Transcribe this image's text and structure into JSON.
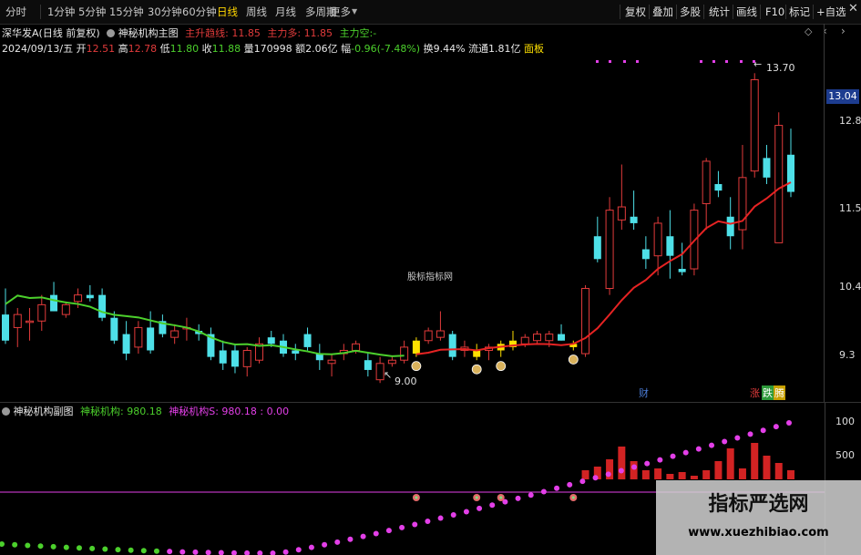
{
  "toolbar": {
    "tabs": [
      "分时",
      "1分钟",
      "5分钟",
      "15分钟",
      "30分钟",
      "60分钟",
      "日线",
      "周线",
      "月线",
      "多周期",
      "更多"
    ],
    "right_buttons": [
      "复权",
      "叠加",
      "多股",
      "统计",
      "画线",
      "F10",
      "标记",
      "+自选"
    ]
  },
  "info": {
    "stock_name": "深华发A",
    "period": "(日线 前复权)",
    "indicator_name": "神秘机构主图",
    "ind1_label": "主升趋线:",
    "ind1_value": "11.85",
    "ind2_label": "主力多:",
    "ind2_value": "11.85",
    "ind3_label": "主力空:",
    "ind3_value": "-",
    "date": "2024/09/13/五",
    "open_label": "开",
    "open": "12.51",
    "high_label": "高",
    "high": "12.78",
    "low_label": "低",
    "low": "11.80",
    "close_label": "收",
    "close": "11.88",
    "vol_label": "量",
    "vol": "170998",
    "amount_label": "额",
    "amount": "2.06亿",
    "change_label": "幅",
    "change": "-0.96(-7.48%)",
    "turnover": "换9.44%",
    "float": "流通1.81亿",
    "panel": "面板"
  },
  "axis": {
    "current_price": "13.04",
    "ticks": [
      "12.8",
      "11.5",
      "10.4",
      "9.3"
    ],
    "sub_ticks": [
      "100",
      "500"
    ]
  },
  "annotations": {
    "high_label": "13.70",
    "low_label": "9.00",
    "watermark_center": "股标指标网",
    "badge_cai": "财",
    "badge_zhang": "涨",
    "badge_die": "跌",
    "badge_teng": "腾"
  },
  "sub": {
    "title": "神秘机构副图",
    "s1_label": "神秘机构:",
    "s1_value": "980.18",
    "s2_label": "神秘机构S:",
    "s2_value": "980.18",
    "s3_value": ": 0.00"
  },
  "watermark": {
    "title": "指标严选网",
    "url": "www.xuezhibiao.com"
  },
  "colors": {
    "up": "#e23b3b",
    "down": "#4ee0e8",
    "ma_green": "#4cd02c",
    "ma_red": "#e62323",
    "yellow": "#ffe100",
    "magenta": "#e33fe8"
  },
  "chart_data": {
    "type": "candlestick",
    "price_range": [
      8.8,
      13.9
    ],
    "candles": [
      {
        "o": 10.0,
        "h": 10.4,
        "l": 9.55,
        "c": 9.6
      },
      {
        "o": 9.8,
        "h": 10.1,
        "l": 9.5,
        "c": 10.0
      },
      {
        "o": 9.9,
        "h": 10.1,
        "l": 9.6,
        "c": 9.9
      },
      {
        "o": 9.9,
        "h": 10.3,
        "l": 9.75,
        "c": 10.15
      },
      {
        "o": 10.3,
        "h": 10.5,
        "l": 10.05,
        "c": 10.05
      },
      {
        "o": 10.0,
        "h": 10.2,
        "l": 9.95,
        "c": 10.15
      },
      {
        "o": 10.2,
        "h": 10.4,
        "l": 10.1,
        "c": 10.3
      },
      {
        "o": 10.3,
        "h": 10.45,
        "l": 10.2,
        "c": 10.25
      },
      {
        "o": 10.3,
        "h": 10.4,
        "l": 9.9,
        "c": 9.95
      },
      {
        "o": 9.95,
        "h": 10.05,
        "l": 9.55,
        "c": 9.6
      },
      {
        "o": 9.7,
        "h": 9.9,
        "l": 9.3,
        "c": 9.4
      },
      {
        "o": 9.5,
        "h": 9.9,
        "l": 9.4,
        "c": 9.8
      },
      {
        "o": 9.8,
        "h": 10.05,
        "l": 9.4,
        "c": 9.45
      },
      {
        "o": 9.9,
        "h": 10.0,
        "l": 9.65,
        "c": 9.7
      },
      {
        "o": 9.65,
        "h": 9.85,
        "l": 9.55,
        "c": 9.75
      },
      {
        "o": 9.8,
        "h": 9.95,
        "l": 9.6,
        "c": 9.8
      },
      {
        "o": 9.75,
        "h": 9.85,
        "l": 9.6,
        "c": 9.7
      },
      {
        "o": 9.7,
        "h": 9.8,
        "l": 9.3,
        "c": 9.35
      },
      {
        "o": 9.45,
        "h": 9.6,
        "l": 9.15,
        "c": 9.25
      },
      {
        "o": 9.45,
        "h": 9.55,
        "l": 9.1,
        "c": 9.2
      },
      {
        "o": 9.2,
        "h": 9.5,
        "l": 9.05,
        "c": 9.45
      },
      {
        "o": 9.3,
        "h": 9.65,
        "l": 9.25,
        "c": 9.55
      },
      {
        "o": 9.65,
        "h": 9.75,
        "l": 9.5,
        "c": 9.55
      },
      {
        "o": 9.6,
        "h": 9.7,
        "l": 9.35,
        "c": 9.4
      },
      {
        "o": 9.45,
        "h": 9.55,
        "l": 9.3,
        "c": 9.4
      },
      {
        "o": 9.7,
        "h": 9.8,
        "l": 9.45,
        "c": 9.5
      },
      {
        "o": 9.4,
        "h": 9.55,
        "l": 9.15,
        "c": 9.3
      },
      {
        "o": 9.25,
        "h": 9.4,
        "l": 9.05,
        "c": 9.3
      },
      {
        "o": 9.4,
        "h": 9.55,
        "l": 9.3,
        "c": 9.45
      },
      {
        "o": 9.45,
        "h": 9.6,
        "l": 9.4,
        "c": 9.55
      },
      {
        "o": 9.3,
        "h": 9.4,
        "l": 9.05,
        "c": 9.15
      },
      {
        "o": 9.0,
        "h": 9.35,
        "l": 8.95,
        "c": 9.25
      },
      {
        "o": 9.25,
        "h": 9.35,
        "l": 9.2,
        "c": 9.3
      },
      {
        "o": 9.3,
        "h": 9.6,
        "l": 9.25,
        "c": 9.5
      },
      {
        "o": 9.4,
        "h": 9.65,
        "l": 9.35,
        "c": 9.6
      },
      {
        "o": 9.6,
        "h": 9.8,
        "l": 9.55,
        "c": 9.75
      },
      {
        "o": 9.65,
        "h": 10.05,
        "l": 9.6,
        "c": 9.75
      },
      {
        "o": 9.7,
        "h": 9.75,
        "l": 9.3,
        "c": 9.35
      },
      {
        "o": 9.45,
        "h": 9.6,
        "l": 9.35,
        "c": 9.5
      },
      {
        "o": 9.45,
        "h": 9.55,
        "l": 9.3,
        "c": 9.35
      },
      {
        "o": 9.45,
        "h": 9.55,
        "l": 9.3,
        "c": 9.5
      },
      {
        "o": 9.55,
        "h": 9.6,
        "l": 9.35,
        "c": 9.45
      },
      {
        "o": 9.6,
        "h": 9.75,
        "l": 9.45,
        "c": 9.5
      },
      {
        "o": 9.55,
        "h": 9.7,
        "l": 9.5,
        "c": 9.65
      },
      {
        "o": 9.6,
        "h": 9.75,
        "l": 9.55,
        "c": 9.7
      },
      {
        "o": 9.6,
        "h": 9.75,
        "l": 9.5,
        "c": 9.7
      },
      {
        "o": 9.7,
        "h": 9.85,
        "l": 9.6,
        "c": 9.6
      },
      {
        "o": 9.5,
        "h": 9.6,
        "l": 9.45,
        "c": 9.55
      },
      {
        "o": 9.4,
        "h": 10.45,
        "l": 9.35,
        "c": 10.4
      },
      {
        "o": 11.2,
        "h": 11.5,
        "l": 10.8,
        "c": 10.85
      },
      {
        "o": 10.4,
        "h": 11.8,
        "l": 10.3,
        "c": 11.6
      },
      {
        "o": 11.45,
        "h": 12.3,
        "l": 11.3,
        "c": 11.65
      },
      {
        "o": 11.5,
        "h": 11.9,
        "l": 11.3,
        "c": 11.4
      },
      {
        "o": 11.0,
        "h": 11.2,
        "l": 10.7,
        "c": 10.85
      },
      {
        "o": 10.9,
        "h": 11.5,
        "l": 10.6,
        "c": 11.4
      },
      {
        "o": 11.2,
        "h": 11.6,
        "l": 10.55,
        "c": 10.9
      },
      {
        "o": 10.7,
        "h": 11.1,
        "l": 10.6,
        "c": 10.65
      },
      {
        "o": 10.7,
        "h": 11.7,
        "l": 10.6,
        "c": 11.6
      },
      {
        "o": 11.7,
        "h": 12.4,
        "l": 11.3,
        "c": 12.35
      },
      {
        "o": 12.0,
        "h": 12.2,
        "l": 11.8,
        "c": 11.9
      },
      {
        "o": 11.5,
        "h": 11.8,
        "l": 11.0,
        "c": 11.2
      },
      {
        "o": 11.3,
        "h": 12.6,
        "l": 11.0,
        "c": 12.1
      },
      {
        "o": 12.2,
        "h": 13.7,
        "l": 12.1,
        "c": 13.6
      },
      {
        "o": 12.4,
        "h": 12.6,
        "l": 12.0,
        "c": 12.1
      },
      {
        "o": 11.1,
        "h": 13.1,
        "l": 11.1,
        "c": 12.9
      },
      {
        "o": 12.45,
        "h": 12.85,
        "l": 11.8,
        "c": 11.88
      }
    ],
    "yellow_indices": [
      34,
      39,
      41,
      42,
      47
    ],
    "money_signal_indices": [
      34,
      39,
      41,
      47
    ],
    "green_ma_start": 0,
    "green_ma_end": 33,
    "red_ma_start": 34,
    "dot_series_count": 62,
    "bar_values": [
      0,
      0,
      0,
      0,
      0,
      0,
      0,
      0,
      0,
      0,
      0,
      0,
      0,
      0,
      0,
      0,
      0,
      0,
      0,
      0,
      0,
      0,
      0,
      0,
      0,
      0,
      0,
      0,
      0,
      0,
      0,
      0,
      0,
      0,
      0,
      0,
      0,
      0,
      0,
      0,
      0,
      0,
      0,
      0,
      0,
      0,
      0,
      0,
      10,
      14,
      22,
      36,
      20,
      10,
      12,
      6,
      8,
      4,
      10,
      20,
      34,
      12,
      40,
      26,
      18,
      10
    ]
  }
}
